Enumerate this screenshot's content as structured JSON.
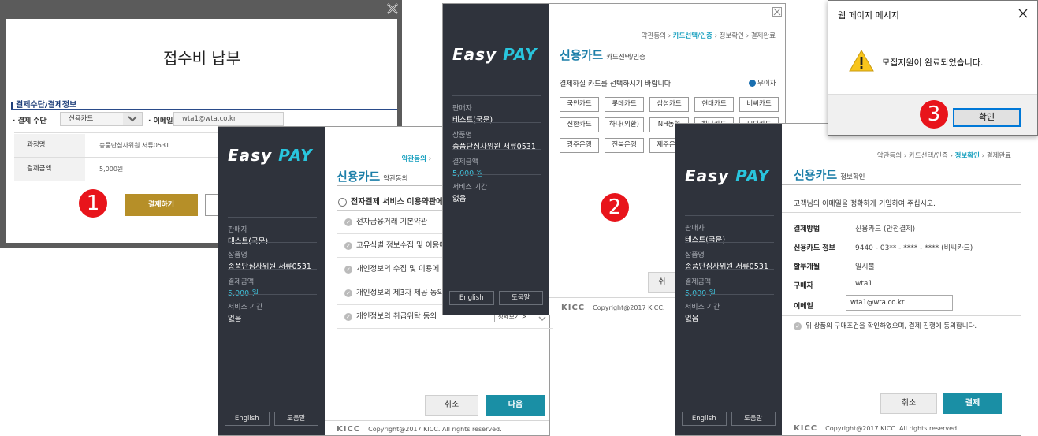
{
  "win1": {
    "title": "접수비 납부",
    "section_label": "결제수단/결제정보",
    "method_label": "결제 수단",
    "method_value": "신용카드",
    "email_label": "이메일",
    "email_value": "wta1@wta.co.kr",
    "table": [
      {
        "k": "과정명",
        "v": "송품단심사위원 서류0531"
      },
      {
        "k": "결제금액",
        "v": "5,000원"
      }
    ],
    "pay_button": "결제하기",
    "marker": "1"
  },
  "sidebar": {
    "logo_a": "Easy ",
    "logo_b": "PAY",
    "seller_label": "판매자",
    "seller": "테스트(국문)",
    "product_label": "상품명",
    "product": "송품단심사위원 서류0531",
    "amount_label": "결제금액",
    "amount": "5,000 원",
    "period_label": "서비스 기간",
    "period": "없음",
    "english": "English",
    "help": "도움말"
  },
  "steps": {
    "s1": "약관동의",
    "s2": "카드선택/인증",
    "s3": "정보확인",
    "s4": "결제완료",
    "sep": "›"
  },
  "win2": {
    "title": "신용카드",
    "subtitle": "약관동의",
    "agree_all": "전자결제 서비스 이용약관에",
    "items": [
      "전자금융거래 기본약관",
      "고유식별 정보수집 및 이용에",
      "개인정보의 수집 및 이용에 대",
      "개인정보의 제3자 제공 동의",
      "개인정보의 취급위탁 동의"
    ],
    "view": "상세보기 >",
    "cancel": "취소",
    "next": "다음",
    "kicc": "KICC",
    "copyright": "Copyright@2017 KICC. All rights reserved."
  },
  "win3": {
    "title": "신용카드",
    "subtitle": "카드선택/인증",
    "instruction": "결제하실 카드를 선택하시기 바랍니다.",
    "interest_free": "무이자",
    "cards": [
      "국민카드",
      "롯데카드",
      "삼성카드",
      "현대카드",
      "비씨카드",
      "신한카드",
      "하나(외환)",
      "NH농협",
      "하나카드",
      "씨티카드",
      "광주은행",
      "전북은행",
      "제주은행"
    ],
    "cancel": "취",
    "kicc": "KICC",
    "copyright": "Copyright@2017 KICC.",
    "marker": "2"
  },
  "win4": {
    "title": "신용카드",
    "subtitle": "정보확인",
    "instruction": "고객님의 이메일을 정확하게 기입하여 주십시오.",
    "rows": [
      {
        "k": "결제방법",
        "v": "신용카드 (안전결제)"
      },
      {
        "k": "신용카드 정보",
        "v": "9440 - 03** - **** - **** (비씨카드)"
      },
      {
        "k": "할부개월",
        "v": "일시불"
      },
      {
        "k": "구매자",
        "v": "wta1"
      }
    ],
    "email_label": "이메일",
    "email_value": "wta1@wta.co.kr",
    "agree": "위 상품의 구매조건을 확인하였으며, 결제 진행에 동의합니다.",
    "cancel": "취소",
    "pay": "결제",
    "kicc": "KICC",
    "copyright": "Copyright@2017 KICC. All rights reserved."
  },
  "dialog": {
    "title": "웹 페이지 메시지",
    "message": "모집지원이 완료되었습니다.",
    "ok": "확인",
    "marker": "3"
  }
}
